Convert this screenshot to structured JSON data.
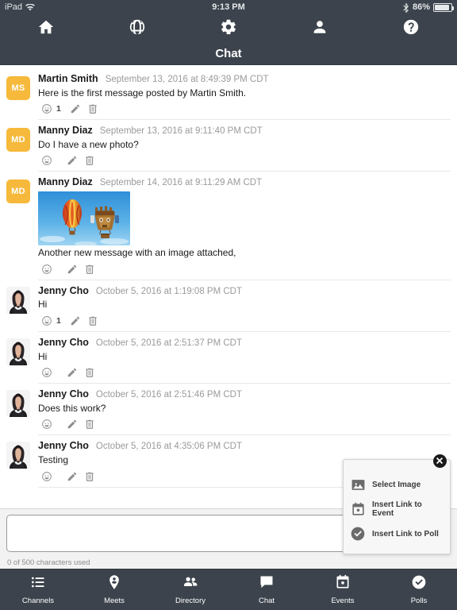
{
  "statusbar": {
    "device": "iPad",
    "wifi_icon": "wifi-icon",
    "time": "9:13 PM",
    "bluetooth_icon": "bluetooth-icon",
    "battery_percent": "86%",
    "battery_icon": "battery-icon"
  },
  "topnav": {
    "items": [
      {
        "name": "home",
        "icon": "home-icon"
      },
      {
        "name": "globe",
        "icon": "globe-icon"
      },
      {
        "name": "settings",
        "icon": "gear-icon"
      },
      {
        "name": "profile",
        "icon": "person-icon"
      },
      {
        "name": "help",
        "icon": "question-mark-icon"
      }
    ]
  },
  "titlebar": {
    "title": "Chat"
  },
  "messages": [
    {
      "author": "Martin Smith",
      "time": "September 13, 2016 at 8:49:39 PM CDT",
      "text": "Here is the first message posted by Martin Smith.",
      "avatar_type": "initials",
      "initials": "MS",
      "avatar_color": "#F6B93B",
      "reaction_count": "1",
      "has_image": false
    },
    {
      "author": "Manny Diaz",
      "time": "September 13, 2016 at 9:11:40 PM CDT",
      "text": "Do I have a new photo?",
      "avatar_type": "initials",
      "initials": "MD",
      "avatar_color": "#F6B93B",
      "reaction_count": "",
      "has_image": false
    },
    {
      "author": "Manny Diaz",
      "time": "September 14, 2016 at 9:11:29 AM CDT",
      "text": "Another new message with an image attached,",
      "avatar_type": "initials",
      "initials": "MD",
      "avatar_color": "#F6B93B",
      "reaction_count": "",
      "has_image": true,
      "image_alt": "hot-air-balloons-photo"
    },
    {
      "author": "Jenny Cho",
      "time": "October 5, 2016 at 1:19:08 PM CDT",
      "text": "Hi",
      "avatar_type": "photo",
      "initials": "",
      "avatar_color": "",
      "reaction_count": "1",
      "has_image": false
    },
    {
      "author": "Jenny Cho",
      "time": "October 5, 2016 at 2:51:37 PM CDT",
      "text": "Hi",
      "avatar_type": "photo",
      "initials": "",
      "avatar_color": "",
      "reaction_count": "",
      "has_image": false
    },
    {
      "author": "Jenny Cho",
      "time": "October 5, 2016 at 2:51:46 PM CDT",
      "text": "Does this work?",
      "avatar_type": "photo",
      "initials": "",
      "avatar_color": "",
      "reaction_count": "",
      "has_image": false
    },
    {
      "author": "Jenny Cho",
      "time": "October 5, 2016 at 4:35:06 PM CDT",
      "text": "Testing",
      "avatar_type": "photo",
      "initials": "",
      "avatar_color": "",
      "reaction_count": "",
      "has_image": false
    }
  ],
  "message_actions": {
    "reaction_icon": "smiley-face-icon",
    "edit_icon": "pencil-icon",
    "delete_icon": "trash-icon"
  },
  "composer": {
    "value": "",
    "placeholder": "",
    "char_count": "0 of 500 characters used"
  },
  "attach_popup": {
    "close_icon": "close-icon",
    "items": [
      {
        "label": "Select Image",
        "icon": "image-icon"
      },
      {
        "label": "Insert Link to Event",
        "icon": "calendar-icon"
      },
      {
        "label": "Insert Link to Poll",
        "icon": "check-circle-icon"
      }
    ]
  },
  "tabbar": {
    "items": [
      {
        "label": "Channels",
        "icon": "list-icon"
      },
      {
        "label": "Meets",
        "icon": "map-pin-person-icon"
      },
      {
        "label": "Directory",
        "icon": "people-icon"
      },
      {
        "label": "Chat",
        "icon": "chat-bubble-icon"
      },
      {
        "label": "Events",
        "icon": "calendar-icon"
      },
      {
        "label": "Polls",
        "icon": "check-circle-icon"
      }
    ]
  },
  "colors": {
    "chrome": "#3C434C",
    "avatar_yellow": "#F6B93B",
    "divider": "#E8E8E8",
    "composer_bg": "#F2F2F2"
  }
}
